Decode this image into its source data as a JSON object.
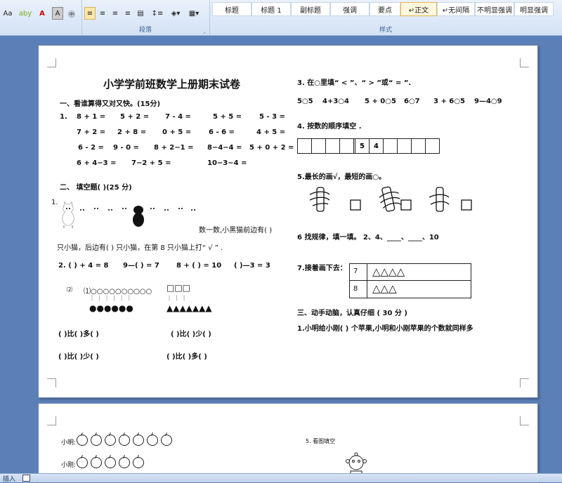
{
  "ribbon": {
    "font_tools": [
      "Aa",
      "aby",
      "A",
      "A",
      "㊥"
    ],
    "paragraph_label": "段落",
    "styles_label": "样式",
    "styles": [
      "标题",
      "标题 1",
      "副标题",
      "强调",
      "要点",
      "↵正文",
      "↵无间隔",
      "不明显强调",
      "明显强调"
    ]
  },
  "page1": {
    "title": "小学学前班数学上册期末试卷",
    "s1": {
      "heading": "一、看谁算得又对又快。(15分)",
      "num": "1.",
      "rows": [
        [
          "8 + 1 =",
          "5 + 2 =",
          "7 - 4 =",
          "5 + 5 =",
          "5 - 3 ="
        ],
        [
          "7 + 2 =",
          "2 + 8 =",
          "0 + 5 =",
          "6 - 6 =",
          "4 + 5 ="
        ],
        [
          "6 - 2 =",
          "9 - 0 =",
          "8 + 2−1 =",
          "8−4−4 =",
          "5 + 0 + 2 ="
        ],
        [
          "6 + 4−3 =",
          "7−2 + 5 =",
          "10−3−4 ="
        ]
      ]
    },
    "s2": {
      "heading": "二、  填空题(   )(25 分)",
      "q1_num": "1.",
      "q1_tail": "数一数,小黑猫前边有(     )",
      "q1_line2": "只小猫，后边有(    )  只小猫，在第 8 只小猫上打“ √ ”  .",
      "q2": [
        "2. (    ) + 4 = 8",
        "9—(    ) = 7",
        "8 + (    ) = 10",
        "(    )—3 = 3"
      ],
      "circle_label": "⑵",
      "circles_row": "⑴○○○○○○○○○○",
      "dots_row": "⋮  ⋮  ⋮  ⋮  ⋮  ⋮",
      "bullets_row": "●●●●●●",
      "squares_row": "□□□",
      "tri_dots": "⋮  ⋮  ⋮",
      "tri_row": "▲▲▲▲▲▲▲",
      "cmp1": [
        "(    )比(    )多(    )",
        "(    )比(    )少(    )"
      ],
      "cmp2": [
        "(    )比(    )少(    )",
        "(    )比(    )多(    )"
      ]
    },
    "right": {
      "q3": "3. 在○里填“ < ”、“ > ”或“ = ”.",
      "q3_items": [
        "5○5",
        "4+3○4",
        "5 + 0○5",
        "6○7",
        "3 + 6○5",
        "9—4○9"
      ],
      "q4": "4. 按数的顺序填空 .",
      "q4_boxes": [
        "",
        "",
        "",
        "",
        "",
        "5",
        "4",
        "",
        "",
        "",
        "",
        ""
      ],
      "q5": "5.最长的画√，最短的画○。",
      "q6": "6 找规律，填一填。  2、4、____、____、10",
      "q7": "7.接着画下去：",
      "q7_rows": [
        {
          "num": "7",
          "shapes": "△△△△"
        },
        {
          "num": "8",
          "shapes": "△△△"
        }
      ],
      "s3": "三、动手动脑，认真仔细 ( 30 分 )",
      "s3_q1": "1.小明给小刚(     ) 个苹果,小明和小刚苹果的个数就同样多"
    }
  },
  "page2": {
    "xiaoming": "小明:",
    "xiaogang": "小刚:",
    "q5": "5. 看图填空",
    "xiaoming_apples": 7,
    "xiaogang_apples": 5
  },
  "status": {
    "mode": "插入"
  }
}
